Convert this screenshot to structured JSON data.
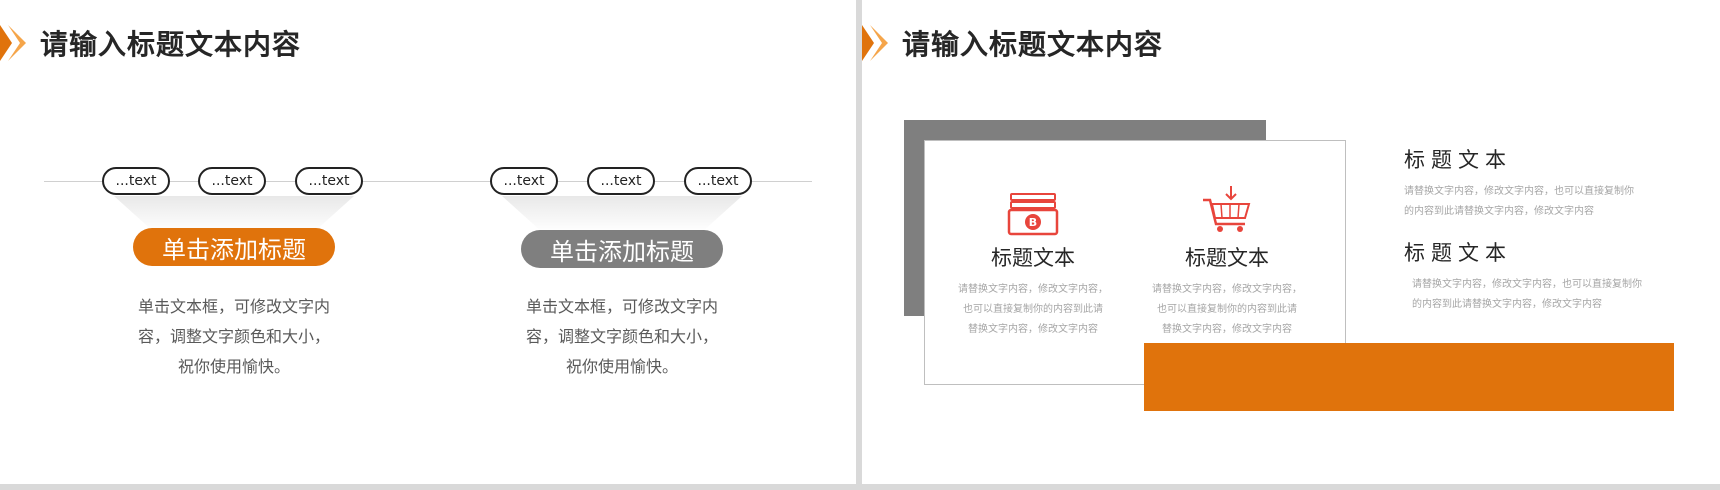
{
  "slides": [
    {
      "title": "请输入标题文本内容",
      "groups": [
        {
          "pills": [
            "...text",
            "...text",
            "...text"
          ],
          "label": "单击添加标题",
          "label_color": "#e0730c",
          "desc_lines": [
            "单击文本框，可修改文字内",
            "容，调整文字颜色和大小，",
            "祝你使用愉快。"
          ]
        },
        {
          "pills": [
            "...text",
            "...text",
            "...text"
          ],
          "label": "单击添加标题",
          "label_color": "#7f7f7f",
          "desc_lines": [
            "单击文本框，可修改文字内",
            "容，调整文字颜色和大小，",
            "祝你使用愉快。"
          ]
        }
      ]
    },
    {
      "title": "请输入标题文本内容",
      "card_items": [
        {
          "icon": "money-icon",
          "title": "标题文本",
          "lines": [
            "请替换文字内容，修改文字内容，",
            "也可以直接复制你的内容到此请",
            "替换文字内容，修改文字内容"
          ]
        },
        {
          "icon": "shopping-cart-icon",
          "title": "标题文本",
          "lines": [
            "请替换文字内容，修改文字内容，",
            "也可以直接复制你的内容到此请",
            "替换文字内容，修改文字内容"
          ]
        }
      ],
      "side_items": [
        {
          "title": "标题文本",
          "lines": [
            "请替换文字内容，修改文字内容，也可以直接复制你",
            "的内容到此请替换文字内容，修改文字内容"
          ]
        },
        {
          "title": "标题文本",
          "lines": [
            "请替换文字内容，修改文字内容，也可以直接复制你",
            "的内容到此请替换文字内容，修改文字内容"
          ]
        }
      ]
    }
  ],
  "colors": {
    "accent": "#e0730c",
    "accent_light": "#f5a54a",
    "gray": "#7f7f7f",
    "icon_red": "#e8453c"
  }
}
